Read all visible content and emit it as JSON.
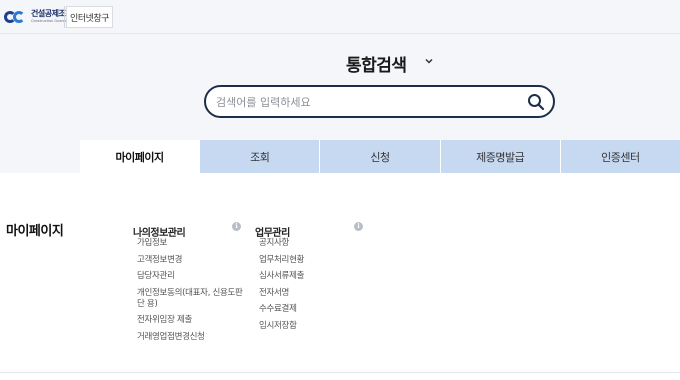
{
  "header": {
    "logo_ko": "건설공제조합",
    "logo_en": "Construction Guarantee",
    "window_tab": "인터넷창구"
  },
  "search": {
    "title": "통합검색",
    "placeholder": "검색어를 입력하세요",
    "value": ""
  },
  "nav": {
    "tabs": [
      {
        "label": "마이페이지",
        "active": true
      },
      {
        "label": "조회",
        "active": false
      },
      {
        "label": "신청",
        "active": false
      },
      {
        "label": "제증명발급",
        "active": false
      },
      {
        "label": "인증센터",
        "active": false
      }
    ]
  },
  "main": {
    "section_title": "마이페이지",
    "groups": [
      {
        "title": "나의정보관리",
        "items": [
          "가입정보",
          "고객정보변경",
          "담당자관리",
          "개인정보동의(대표자, 신용도판단 용)",
          "전자위임장 제출",
          "거래영업점변경신청"
        ]
      },
      {
        "title": "업무관리",
        "items": [
          "공지사항",
          "업무처리현황",
          "심사서류제출",
          "전자서명",
          "수수료결제",
          "임시저장함"
        ]
      }
    ]
  },
  "colors": {
    "tab_bg": "#c7d9f1",
    "top_bg": "#f4f6f9",
    "search_border": "#1e2e4a",
    "logo_navy": "#1c3f94",
    "logo_blue": "#2a7bd3"
  },
  "icons": [
    "logo-mark-icon",
    "chevron-down-icon",
    "search-icon",
    "info-icon"
  ]
}
